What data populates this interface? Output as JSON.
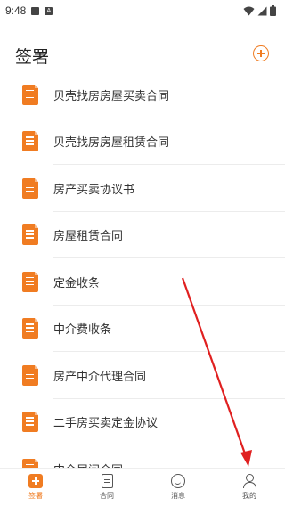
{
  "status_bar": {
    "time": "9:48",
    "icon_a": "A"
  },
  "header": {
    "title": "签署",
    "add_icon": "plus-circle-icon"
  },
  "contracts": [
    {
      "label": "贝壳找房房屋买卖合同"
    },
    {
      "label": "贝壳找房房屋租赁合同"
    },
    {
      "label": "房产买卖协议书"
    },
    {
      "label": "房屋租赁合同"
    },
    {
      "label": "定金收条"
    },
    {
      "label": "中介费收条"
    },
    {
      "label": "房产中介代理合同"
    },
    {
      "label": "二手房买卖定金协议"
    },
    {
      "label": "中介居间合同"
    }
  ],
  "tab_bar": {
    "sign": "签署",
    "contract": "合同",
    "message": "消息",
    "me": "我的"
  },
  "colors": {
    "accent": "#f07c22",
    "annotation": "#e02020"
  }
}
